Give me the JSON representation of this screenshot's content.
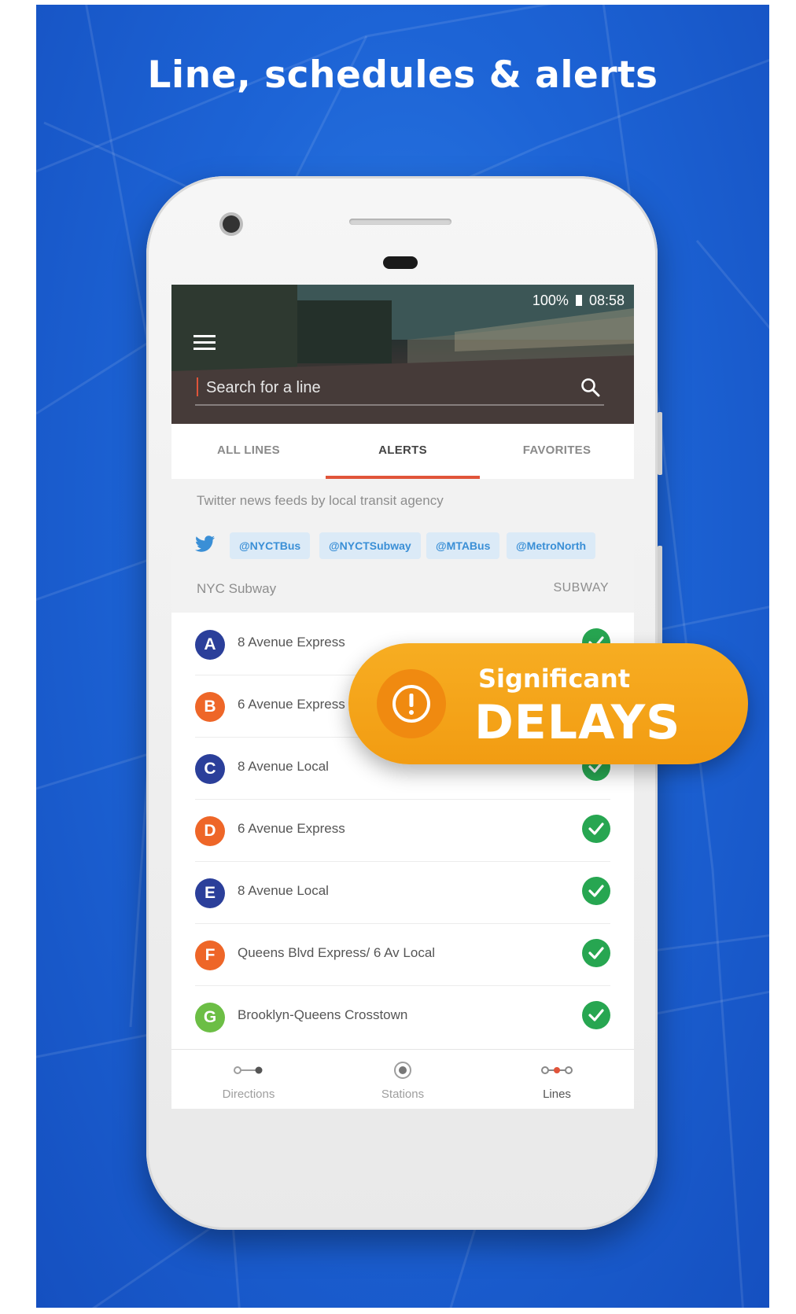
{
  "headline": "Line, schedules & alerts",
  "status_bar": {
    "battery": "100%",
    "time": "08:58"
  },
  "search": {
    "placeholder": "Search for a line"
  },
  "tabs": [
    {
      "label": "ALL LINES",
      "active": false
    },
    {
      "label": "ALERTS",
      "active": true
    },
    {
      "label": "FAVORITES",
      "active": false
    }
  ],
  "feeds": {
    "title": "Twitter news feeds by local transit agency",
    "handles": [
      "@NYCTBus",
      "@NYCTSubway",
      "@MTABus",
      "@MetroNorth"
    ]
  },
  "subway_section": {
    "title": "NYC Subway",
    "type": "SUBWAY"
  },
  "lines": [
    {
      "letter": "A",
      "name": "8 Avenue Express",
      "color": "#2b3f9a",
      "status": "ok"
    },
    {
      "letter": "B",
      "name": "6 Avenue Express",
      "color": "#ee6628",
      "status": "ok"
    },
    {
      "letter": "C",
      "name": "8 Avenue Local",
      "color": "#2b3f9a",
      "status": "ok"
    },
    {
      "letter": "D",
      "name": "6 Avenue Express",
      "color": "#ee6628",
      "status": "ok"
    },
    {
      "letter": "E",
      "name": "8 Avenue Local",
      "color": "#2b3f9a",
      "status": "ok"
    },
    {
      "letter": "F",
      "name": "Queens Blvd Express/ 6 Av Local",
      "color": "#ee6628",
      "status": "ok"
    },
    {
      "letter": "G",
      "name": "Brooklyn-Queens Crosstown",
      "color": "#6cbe45",
      "status": "ok"
    }
  ],
  "bottom_nav": [
    {
      "label": "Directions",
      "icon": "directions-icon",
      "active": false
    },
    {
      "label": "Stations",
      "icon": "station-icon",
      "active": false
    },
    {
      "label": "Lines",
      "icon": "lines-icon",
      "active": true
    }
  ],
  "alert_toast": {
    "line1": "Significant",
    "line2": "DELAYS",
    "icon": "exclamation-icon"
  },
  "colors": {
    "accent": "#e0543a",
    "ok": "#27a651",
    "toast": "#f4a31a",
    "poster_bg": "#1d64d6",
    "twitter": "#3a8fd6"
  }
}
